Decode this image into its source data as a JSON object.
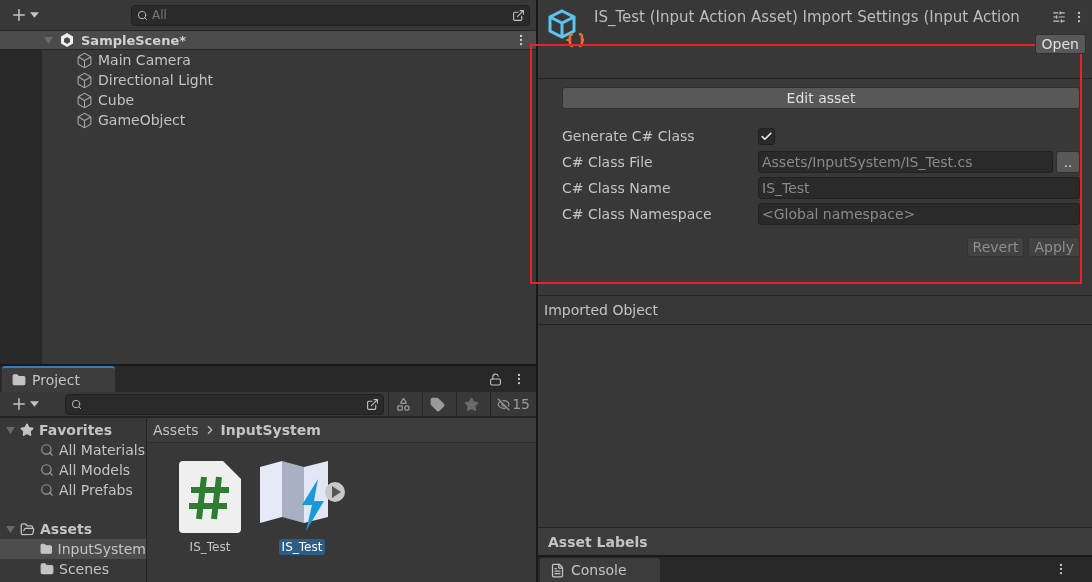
{
  "hierarchy": {
    "search": {
      "placeholder": "All"
    },
    "scene": {
      "name": "SampleScene*",
      "expanded": true
    },
    "objects": [
      {
        "name": "Main Camera"
      },
      {
        "name": "Directional Light"
      },
      {
        "name": "Cube"
      },
      {
        "name": "GameObject"
      }
    ]
  },
  "project": {
    "tab": "Project",
    "hidden_count": "15",
    "favorites": {
      "label": "Favorites",
      "expanded": true,
      "items": [
        {
          "label": "All Materials"
        },
        {
          "label": "All Models"
        },
        {
          "label": "All Prefabs"
        }
      ]
    },
    "assets": {
      "label": "Assets",
      "expanded": true,
      "children": [
        {
          "label": "InputSystem",
          "selected": true
        },
        {
          "label": "Scenes",
          "selected": false
        }
      ]
    },
    "breadcrumb": [
      "Assets",
      "InputSystem"
    ],
    "files": [
      {
        "name": "IS_Test",
        "kind": "script",
        "selected": false
      },
      {
        "name": "IS_Test",
        "kind": "input_actions",
        "selected": true
      }
    ]
  },
  "inspector": {
    "title": "IS_Test (Input Action Asset) Import Settings (Input Action",
    "open_button": "Open",
    "edit_button": "Edit asset",
    "fields": [
      {
        "kind": "checkbox",
        "label": "Generate C# Class",
        "checked": true
      },
      {
        "kind": "file",
        "label": "C# Class File",
        "value": "Assets/InputSystem/IS_Test.cs",
        "button": ".."
      },
      {
        "kind": "text",
        "label": "C# Class Name",
        "value": "IS_Test"
      },
      {
        "kind": "text",
        "label": "C# Class Namespace",
        "placeholder": "<Global namespace>"
      }
    ],
    "buttons": [
      "Revert",
      "Apply"
    ],
    "imported_object": "Imported Object",
    "asset_labels": "Asset Labels"
  },
  "console": {
    "tab": "Console"
  }
}
